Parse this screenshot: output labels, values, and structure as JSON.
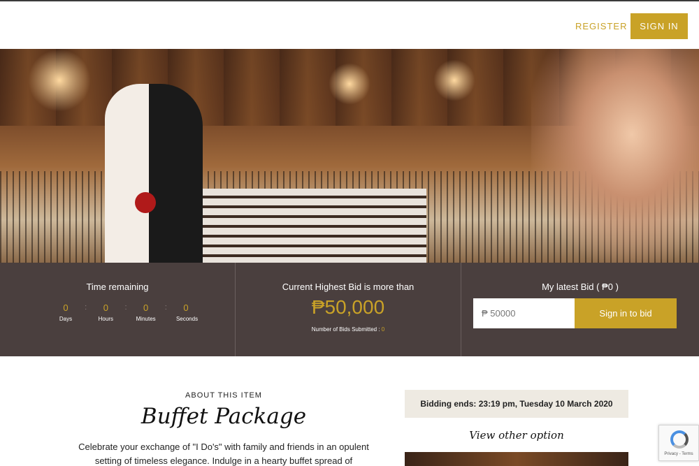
{
  "header": {
    "register_label": "REGISTER",
    "signin_label": "SIGN IN"
  },
  "hero": {
    "slide_count": 3,
    "active_slide": 3
  },
  "timer": {
    "title": "Time remaining",
    "units": [
      {
        "value": "0",
        "label": "Days"
      },
      {
        "value": "0",
        "label": "Hours"
      },
      {
        "value": "0",
        "label": "Minutes"
      },
      {
        "value": "0",
        "label": "Seconds"
      }
    ],
    "separator": ":"
  },
  "highest_bid": {
    "title": "Current Highest Bid is more than",
    "amount": "₱50,000",
    "count_label": "Number of Bids Submitted :",
    "count": "0"
  },
  "my_bid": {
    "title": "My latest Bid ( ₱0 )",
    "input_placeholder": "₱ 50000",
    "button_label": "Sign in to bid"
  },
  "about": {
    "eyebrow": "ABOUT THIS ITEM",
    "title": "Buffet Package",
    "description": "Celebrate your exchange of \"I Do's\" with family and friends in an opulent setting of timeless elegance. Indulge in a hearty buffet spread of"
  },
  "side": {
    "bidding_ends": "Bidding ends: 23:19 pm, Tuesday 10 March 2020",
    "view_other": "View other option"
  },
  "recaptcha": {
    "footer": "Privacy - Terms"
  },
  "colors": {
    "accent": "#c9a227",
    "infobar_bg": "#4a3f3e",
    "bidding_bg": "#eeeae2"
  }
}
